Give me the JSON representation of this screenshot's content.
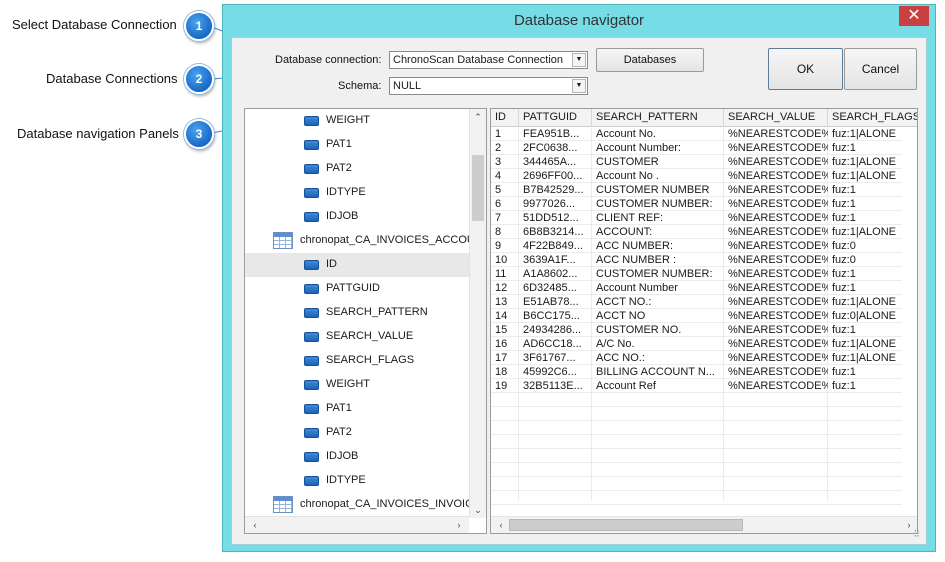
{
  "annotations": [
    {
      "number": "1",
      "label": "Select Database Connection"
    },
    {
      "number": "2",
      "label": "Database Connections"
    },
    {
      "number": "3",
      "label": "Database navigation Panels"
    }
  ],
  "window": {
    "title": "Database navigator",
    "close_glyph": "✕",
    "accent": "#76dde6"
  },
  "form": {
    "connection_label": "Database connection:",
    "connection_value": "ChronoScan Database Connection",
    "schema_label": "Schema:",
    "schema_value": "NULL",
    "databases_button": "Databases",
    "ok_button": "OK",
    "cancel_button": "Cancel"
  },
  "tree": {
    "items": [
      {
        "kind": "field",
        "label": "WEIGHT"
      },
      {
        "kind": "field",
        "label": "PAT1"
      },
      {
        "kind": "field",
        "label": "PAT2"
      },
      {
        "kind": "field",
        "label": "IDTYPE"
      },
      {
        "kind": "field",
        "label": "IDJOB"
      },
      {
        "kind": "table",
        "label": "chronopat_CA_INVOICES_ACCOUN"
      },
      {
        "kind": "field",
        "label": "ID",
        "selected": true
      },
      {
        "kind": "field",
        "label": "PATTGUID"
      },
      {
        "kind": "field",
        "label": "SEARCH_PATTERN"
      },
      {
        "kind": "field",
        "label": "SEARCH_VALUE"
      },
      {
        "kind": "field",
        "label": "SEARCH_FLAGS"
      },
      {
        "kind": "field",
        "label": "WEIGHT"
      },
      {
        "kind": "field",
        "label": "PAT1"
      },
      {
        "kind": "field",
        "label": "PAT2"
      },
      {
        "kind": "field",
        "label": "IDJOB"
      },
      {
        "kind": "field",
        "label": "IDTYPE"
      },
      {
        "kind": "table",
        "label": "chronopat_CA_INVOICES_INVOICE"
      }
    ]
  },
  "grid": {
    "columns": [
      "ID",
      "PATTGUID",
      "SEARCH_PATTERN",
      "SEARCH_VALUE",
      "SEARCH_FLAGS"
    ],
    "rows": [
      [
        "1",
        "FEA951B...",
        "Account No.",
        "%NEARESTCODE%",
        "fuz:1|ALONE"
      ],
      [
        "2",
        "2FC0638...",
        "Account Number:",
        "%NEARESTCODE%",
        "fuz:1"
      ],
      [
        "3",
        "344465A...",
        "CUSTOMER",
        "%NEARESTCODE%",
        "fuz:1|ALONE"
      ],
      [
        "4",
        "2696FF00...",
        "Account No .",
        "%NEARESTCODE%",
        "fuz:1|ALONE"
      ],
      [
        "5",
        "B7B42529...",
        "CUSTOMER NUMBER",
        "%NEARESTCODE%",
        "fuz:1"
      ],
      [
        "6",
        "9977026...",
        "CUSTOMER NUMBER:",
        "%NEARESTCODE%",
        "fuz:1"
      ],
      [
        "7",
        "51DD512...",
        "CLIENT REF:",
        "%NEARESTCODE%",
        "fuz:1"
      ],
      [
        "8",
        "6B8B3214...",
        "ACCOUNT:",
        "%NEARESTCODE%",
        "fuz:1|ALONE"
      ],
      [
        "9",
        "4F22B849...",
        "ACC NUMBER:",
        "%NEARESTCODE%",
        "fuz:0"
      ],
      [
        "10",
        "3639A1F...",
        "ACC NUMBER :",
        "%NEARESTCODE%",
        "fuz:0"
      ],
      [
        "11",
        "A1A8602...",
        "CUSTOMER NUMBER:",
        "%NEARESTCODE%",
        "fuz:1"
      ],
      [
        "12",
        "6D32485...",
        "Account Number",
        "%NEARESTCODE%",
        "fuz:1"
      ],
      [
        "13",
        "E51AB78...",
        "ACCT NO.:",
        "%NEARESTCODE%",
        "fuz:1|ALONE"
      ],
      [
        "14",
        "B6CC175...",
        "ACCT NO",
        "%NEARESTCODE%",
        "fuz:0|ALONE"
      ],
      [
        "15",
        "24934286...",
        "CUSTOMER NO.",
        "%NEARESTCODE%",
        "fuz:1"
      ],
      [
        "16",
        "AD6CC18...",
        "A/C No.",
        "%NEARESTCODE%",
        "fuz:1|ALONE"
      ],
      [
        "17",
        "3F61767...",
        "ACC NO.:",
        "%NEARESTCODE%",
        "fuz:1|ALONE"
      ],
      [
        "18",
        "45992C6...",
        "BILLING ACCOUNT N...",
        "%NEARESTCODE%",
        "fuz:1"
      ],
      [
        "19",
        "32B5113E...",
        "Account Ref",
        "%NEARESTCODE%",
        "fuz:1"
      ]
    ]
  }
}
